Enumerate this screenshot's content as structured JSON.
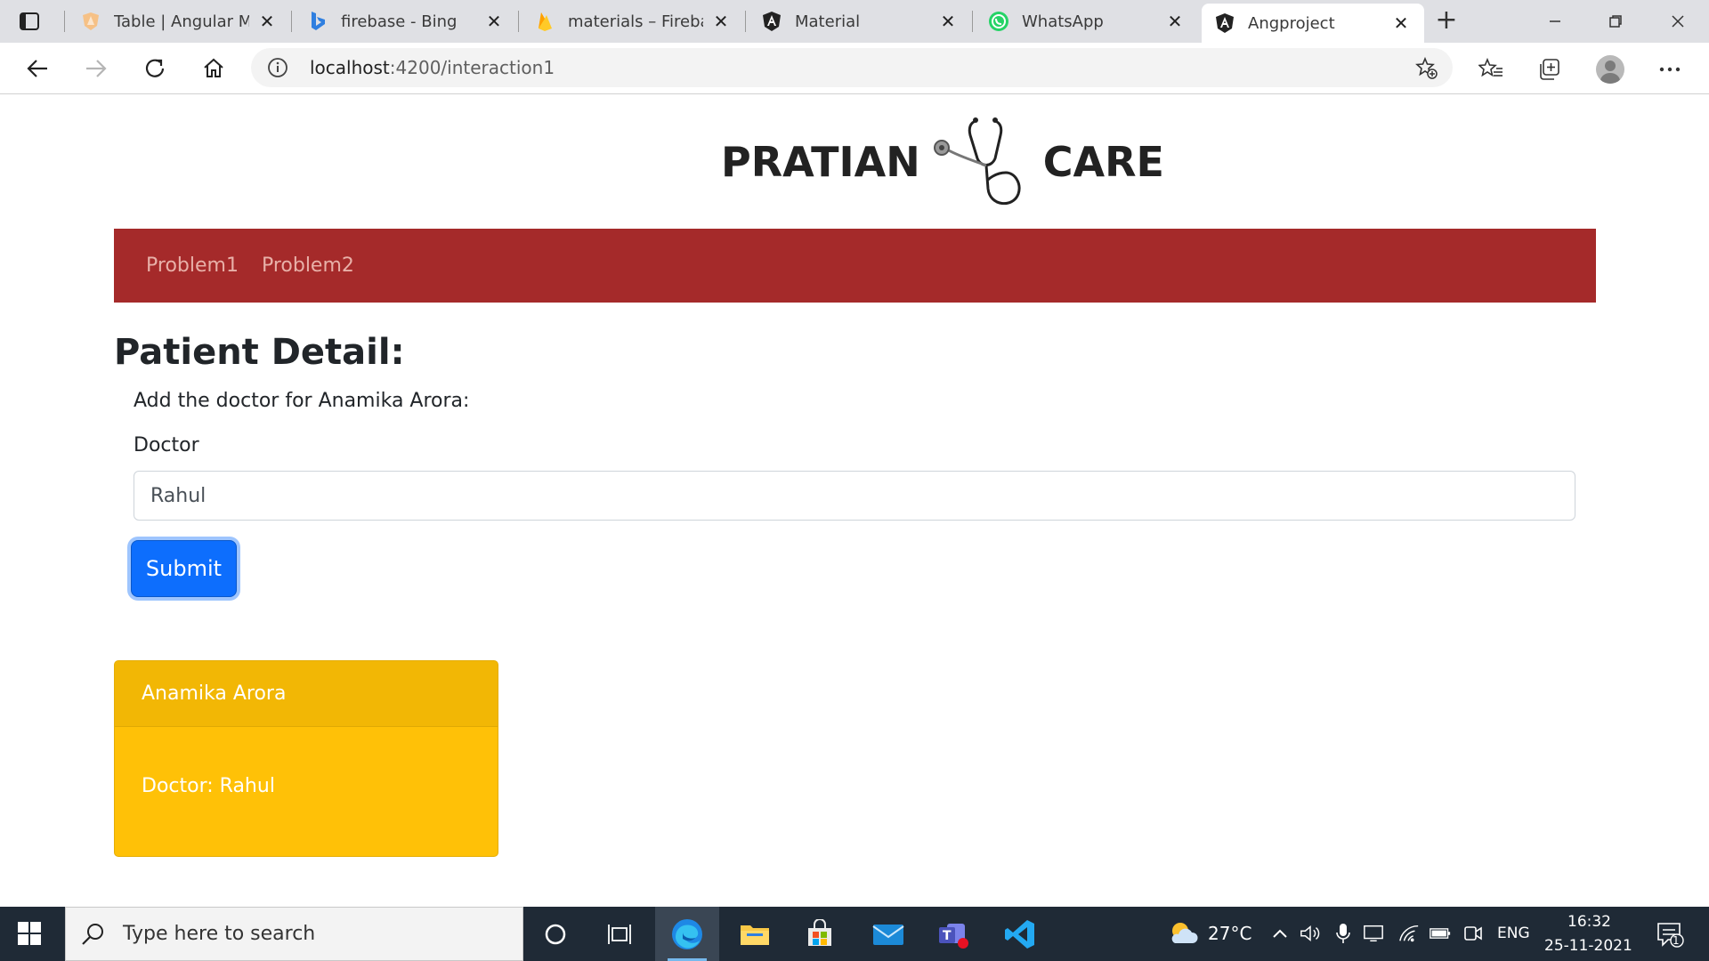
{
  "browser": {
    "tabs": [
      {
        "title": "Table | Angular Mat",
        "icon": "angular-material-shield-icon"
      },
      {
        "title": "firebase - Bing",
        "icon": "bing-icon"
      },
      {
        "title": "materials – Firebase",
        "icon": "firebase-icon"
      },
      {
        "title": "Material",
        "icon": "angular-icon"
      },
      {
        "title": "WhatsApp",
        "icon": "whatsapp-icon"
      },
      {
        "title": "Angproject",
        "icon": "angular-icon",
        "active": true
      }
    ],
    "url_host": "localhost",
    "url_rest": ":4200/interaction1"
  },
  "page": {
    "brand_left": "PRATIAN",
    "brand_right": "CARE",
    "nav_links": [
      "Problem1",
      "Problem2"
    ],
    "heading": "Patient Detail:",
    "prompt": "Add the doctor for Anamika Arora:",
    "doctor_label": "Doctor",
    "doctor_value": "Rahul",
    "submit_label": "Submit",
    "card": {
      "header": "Anamika Arora",
      "body": "Doctor: Rahul"
    },
    "colors": {
      "navbar": "#a52a2a",
      "submit": "#0d6efd",
      "card": "#ffc107"
    }
  },
  "taskbar": {
    "search_placeholder": "Type here to search",
    "weather": "27°C",
    "language": "ENG",
    "time": "16:32",
    "date": "25-11-2021",
    "notification_count": "1"
  }
}
